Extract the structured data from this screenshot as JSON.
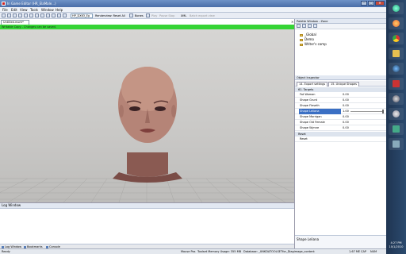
{
  "window": {
    "title": "In Game Editor (HR_ElaMale...)",
    "min": "—",
    "max": "□",
    "close": "✕"
  },
  "menu": [
    "File",
    "Edit",
    "View",
    "Tools",
    "Window",
    "Help"
  ],
  "toolbar": {
    "preset": "HP_DX63_Ep",
    "renderview": "Renderview: Reset All",
    "bones_label": "Bones",
    "play_btn": "Play",
    "pause_btn": "Pause Stop",
    "xml_label": "XML",
    "batch_export": "Batch export view"
  },
  "doc_tab": {
    "label": "Untitled.morh*",
    "close": "✕"
  },
  "writable_banner": "Writable Copy - Changes can be saved.",
  "log": {
    "title": "Log Window",
    "tabs": [
      "Log Window",
      "Bookmarks",
      "Console"
    ]
  },
  "status": {
    "ready": "Ready",
    "mouse_pos": "Mouse Pos",
    "memory": "Toolset Memory Usage: 355 MB",
    "database": "Database: _UNKDATOOLSETfor_Diagimage_content",
    "mb": "1.67 ME",
    "cap": "CAP",
    "num": "NUM"
  },
  "palette": {
    "title": "Palette Window - Zone",
    "items": [
      "_Global",
      "Demo",
      "Writer's comp"
    ]
  },
  "inspector": {
    "title": "Object Inspector",
    "tabs": [
      "14. Export settings",
      "15. Unique Shapes"
    ],
    "section_targets": "61. Targets",
    "rows": [
      {
        "name": "Fat Woman",
        "value": "0.00"
      },
      {
        "name": "Shape Grunt",
        "value": "0.00"
      },
      {
        "name": "Shape Fleseth",
        "value": "0.00"
      },
      {
        "name": "Shape Leliana",
        "value": "1.00"
      },
      {
        "name": "Shape Morrigan",
        "value": "0.00"
      },
      {
        "name": "Shape Old Female",
        "value": "0.00"
      },
      {
        "name": "Shape Wynne",
        "value": "0.00"
      }
    ],
    "selected_index": 3,
    "section_reset": "Reset",
    "reset_row": "Reset",
    "description": "Shape Leliana"
  },
  "tray": {
    "time": "4:27 PM",
    "date": "10/1/2010"
  },
  "taskbar_icons": [
    "start-orb-icon",
    "firefox-icon",
    "chrome-icon",
    "explorer-icon",
    "media-player-icon",
    "toolset-icon",
    "steam-icon",
    "settings-icon",
    "shield-icon",
    "app-icon"
  ],
  "colors": {
    "writable_banner": "#35d435",
    "selection": "#3a6fc4",
    "taskbar": "#1f3552"
  }
}
